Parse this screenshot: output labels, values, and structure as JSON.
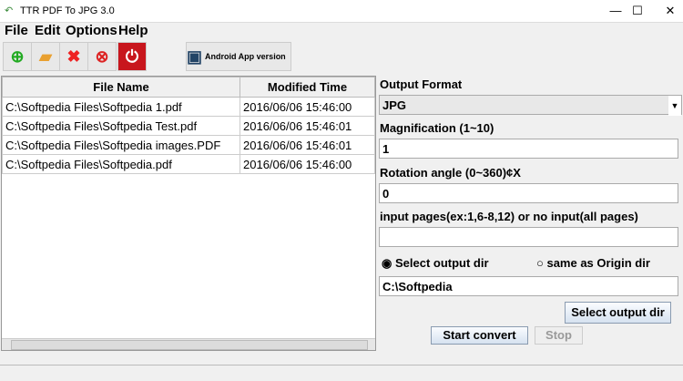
{
  "title": "TTR PDF To JPG 3.0",
  "menu": [
    "File",
    "Edit",
    "Options",
    "Help"
  ],
  "toolbar": {
    "android": "Android App version"
  },
  "table": {
    "headers": [
      "File Name",
      "Modified Time"
    ],
    "rows": [
      [
        "C:\\Softpedia Files\\Softpedia 1.pdf",
        "2016/06/06 15:46:00"
      ],
      [
        "C:\\Softpedia Files\\Softpedia Test.pdf",
        "2016/06/06 15:46:01"
      ],
      [
        "C:\\Softpedia Files\\Softpedia images.PDF",
        "2016/06/06 15:46:01"
      ],
      [
        "C:\\Softpedia Files\\Softpedia.pdf",
        "2016/06/06 15:46:00"
      ]
    ]
  },
  "form": {
    "format_label": "Output Format",
    "format_value": "JPG",
    "mag_label": "Magnification (1~10)",
    "mag_value": "1",
    "rot_label": "Rotation angle (0~360)¢X",
    "rot_value": "0",
    "pages_label": "input pages(ex:1,6-8,12) or no input(all pages)",
    "pages_value": "",
    "radio_select": "Select output dir",
    "radio_same": "same as Origin dir",
    "dir_value": "C:\\Softpedia",
    "select_dir_btn": "Select output dir",
    "start_btn": "Start convert",
    "stop_btn": "Stop"
  }
}
